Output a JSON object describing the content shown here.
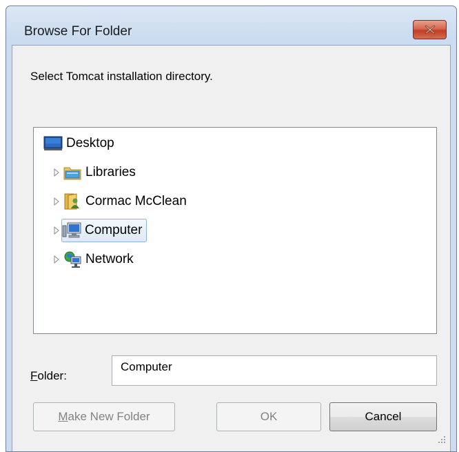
{
  "window": {
    "title": "Browse For Folder",
    "prompt": "Select Tomcat installation directory."
  },
  "tree": {
    "items": [
      {
        "label": "Desktop",
        "icon": "desktop-icon",
        "expandable": false,
        "selected": false
      },
      {
        "label": "Libraries",
        "icon": "libraries-icon",
        "expandable": true,
        "selected": false
      },
      {
        "label": "Cormac  McClean",
        "icon": "user-folder-icon",
        "expandable": true,
        "selected": false
      },
      {
        "label": "Computer",
        "icon": "computer-icon",
        "expandable": true,
        "selected": true
      },
      {
        "label": "Network",
        "icon": "network-icon",
        "expandable": true,
        "selected": false
      }
    ]
  },
  "folder": {
    "label_accel": "F",
    "label_rest": "older:",
    "value": "Computer"
  },
  "buttons": {
    "make_new_folder_accel": "M",
    "make_new_folder_rest": "ake New Folder",
    "ok": "OK",
    "cancel": "Cancel"
  },
  "colors": {
    "selection_border": "#8db2e3",
    "close_button": "#c23e22",
    "frame": "#cbdcf0"
  }
}
